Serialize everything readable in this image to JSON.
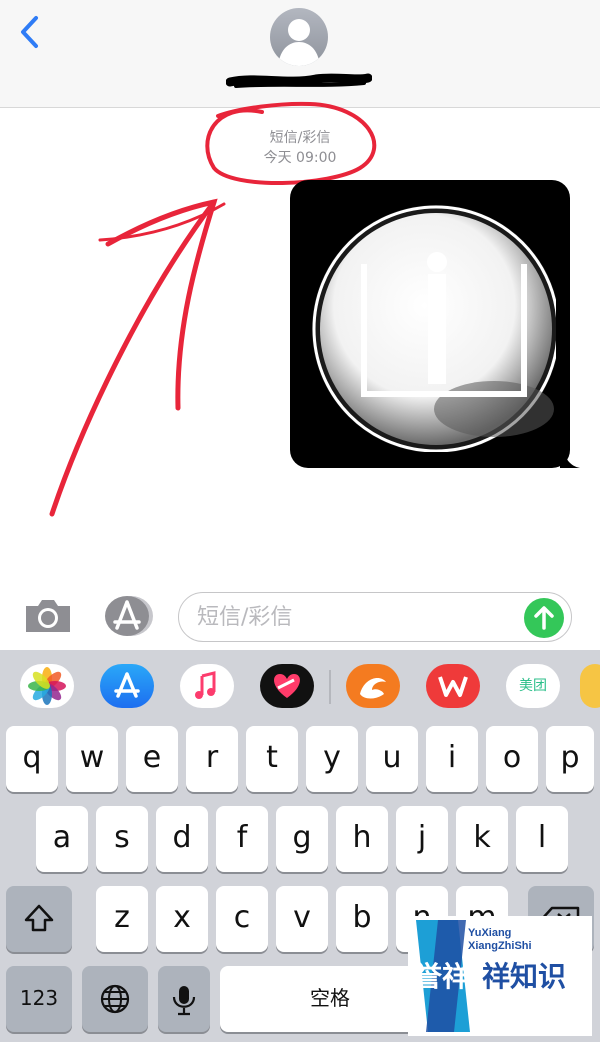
{
  "conversation": {
    "service_label": "短信/彩信",
    "time_label": "今天 09:00"
  },
  "input_bar": {
    "placeholder": "短信/彩信"
  },
  "app_strip": [
    {
      "name": "photos-app-icon"
    },
    {
      "name": "app-store-icon"
    },
    {
      "name": "music-app-icon"
    },
    {
      "name": "digital-touch-icon"
    },
    {
      "name": "uc-browser-icon"
    },
    {
      "name": "wps-office-icon"
    },
    {
      "name": "meituan-icon",
      "label": "美团"
    }
  ],
  "keyboard": {
    "row1": [
      "q",
      "w",
      "e",
      "r",
      "t",
      "y",
      "u",
      "i",
      "o",
      "p"
    ],
    "row2": [
      "a",
      "s",
      "d",
      "f",
      "g",
      "h",
      "j",
      "k",
      "l"
    ],
    "row3": [
      "z",
      "x",
      "c",
      "v",
      "b",
      "n",
      "m"
    ],
    "numbers_label": "123",
    "space_label": "空格"
  },
  "watermark": {
    "line1": "YuXiang",
    "line2": "XiangZhiShi",
    "logo_text": "誉祥",
    "title": "祥知识"
  },
  "colors": {
    "ios_blue": "#2f7cf6",
    "send_green": "#34c759",
    "annotation_red": "#e8253a",
    "keyboard_bg": "#d1d3d9"
  }
}
